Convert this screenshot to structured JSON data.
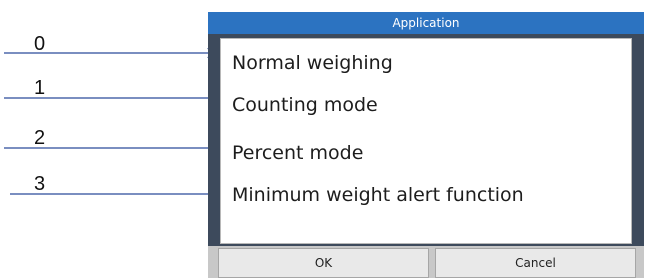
{
  "annotations": [
    {
      "number": "0"
    },
    {
      "number": "1"
    },
    {
      "number": "2"
    },
    {
      "number": "3"
    }
  ],
  "dialog": {
    "title": "Application",
    "options": [
      {
        "label": "Normal weighing"
      },
      {
        "label": "Counting mode"
      },
      {
        "label": "Percent mode"
      },
      {
        "label": "Minimum weight alert function"
      }
    ],
    "ok_label": "OK",
    "cancel_label": "Cancel"
  },
  "colors": {
    "title_bar": "#2c73c1",
    "window_frame": "#3d4a5c",
    "arrow": "#2a4b9a"
  }
}
